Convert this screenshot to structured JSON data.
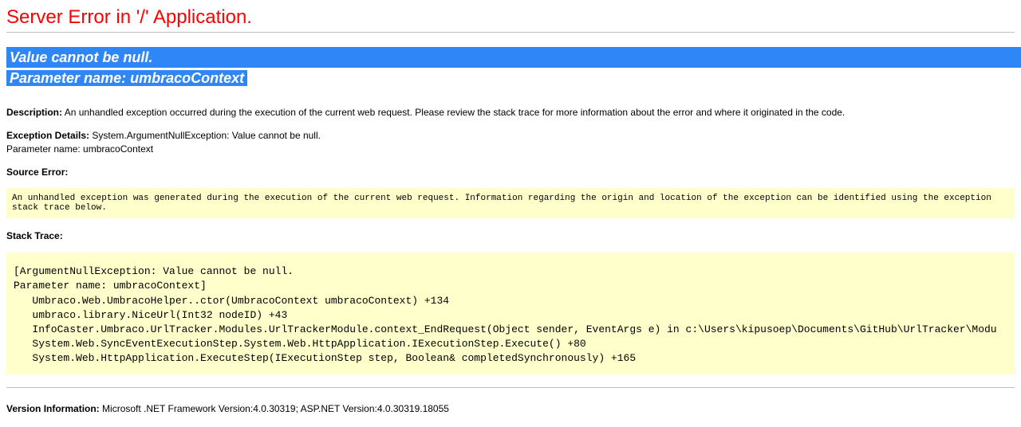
{
  "header": {
    "title": "Server Error in '/' Application."
  },
  "error": {
    "message_line1": "Value cannot be null.",
    "message_line2": "Parameter name: umbracoContext"
  },
  "description": {
    "label": "Description:",
    "text": "An unhandled exception occurred during the execution of the current web request. Please review the stack trace for more information about the error and where it originated in the code."
  },
  "exception_details": {
    "label": "Exception Details:",
    "text": "System.ArgumentNullException: Value cannot be null.",
    "text2": "Parameter name: umbracoContext"
  },
  "source_error": {
    "label": "Source Error:",
    "box_text": "An unhandled exception was generated during the execution of the current web request. Information regarding the origin and location of the exception can be identified using the exception stack trace below."
  },
  "stack_trace": {
    "label": "Stack Trace:",
    "content": "[ArgumentNullException: Value cannot be null.\nParameter name: umbracoContext]\n   Umbraco.Web.UmbracoHelper..ctor(UmbracoContext umbracoContext) +134\n   umbraco.library.NiceUrl(Int32 nodeID) +43\n   InfoCaster.Umbraco.UrlTracker.Modules.UrlTrackerModule.context_EndRequest(Object sender, EventArgs e) in c:\\Users\\kipusoep\\Documents\\GitHub\\UrlTracker\\Modu\n   System.Web.SyncEventExecutionStep.System.Web.HttpApplication.IExecutionStep.Execute() +80\n   System.Web.HttpApplication.ExecuteStep(IExecutionStep step, Boolean& completedSynchronously) +165"
  },
  "version": {
    "label": "Version Information:",
    "text": "Microsoft .NET Framework Version:4.0.30319; ASP.NET Version:4.0.30319.18055"
  }
}
